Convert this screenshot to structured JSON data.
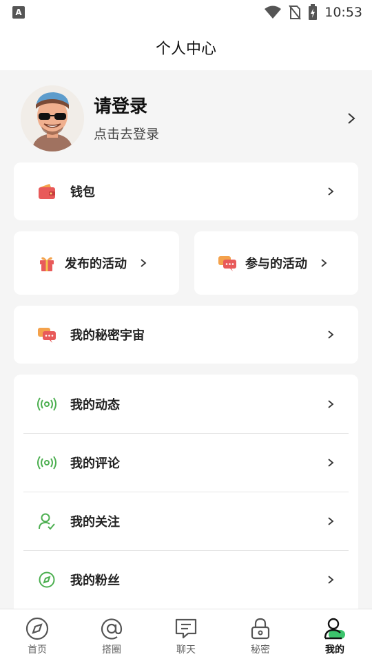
{
  "status": {
    "time": "10:53",
    "app_badge": "A"
  },
  "header": {
    "title": "个人中心"
  },
  "profile": {
    "name": "请登录",
    "subtitle": "点击去登录"
  },
  "menu": {
    "wallet": "钱包",
    "published_activities": "发布的活动",
    "joined_activities": "参与的活动",
    "secret_universe": "我的秘密宇宙",
    "list": [
      {
        "label": "我的动态",
        "icon": "broadcast-icon"
      },
      {
        "label": "我的评论",
        "icon": "broadcast-icon"
      },
      {
        "label": "我的关注",
        "icon": "user-check-icon"
      },
      {
        "label": "我的粉丝",
        "icon": "compass-icon"
      }
    ]
  },
  "tabs": [
    {
      "label": "首页",
      "icon": "compass-icon"
    },
    {
      "label": "搭圈",
      "icon": "at-icon"
    },
    {
      "label": "聊天",
      "icon": "chat-icon"
    },
    {
      "label": "秘密",
      "icon": "lock-icon"
    },
    {
      "label": "我的",
      "icon": "profile-icon",
      "active": true
    }
  ],
  "colors": {
    "accent": "#3cc46c",
    "icon_green": "#4caf50"
  }
}
